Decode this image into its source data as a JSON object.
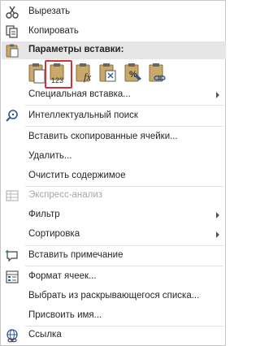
{
  "menu": {
    "cut": "Вырезать",
    "copy": "Копировать",
    "paste_options_header": "Параметры вставки:",
    "paste_values_badge": "123",
    "paste_special": "Специальная вставка...",
    "smart_lookup": "Интеллектуальный поиск",
    "insert_copied_cells": "Вставить скопированные ячейки...",
    "delete": "Удалить...",
    "clear_contents": "Очистить содержимое",
    "quick_analysis": "Экспресс-анализ",
    "filter": "Фильтр",
    "sort": "Сортировка",
    "insert_comment": "Вставить примечание",
    "format_cells": "Формат ячеек...",
    "pick_from_dropdown": "Выбрать из раскрывающегося списка...",
    "define_name": "Присвоить имя...",
    "link": "Ссылка"
  },
  "colors": {
    "selected_outline": "#d13438",
    "clipboard_tan": "#c8a86b",
    "icon_blue": "#2b5797"
  }
}
